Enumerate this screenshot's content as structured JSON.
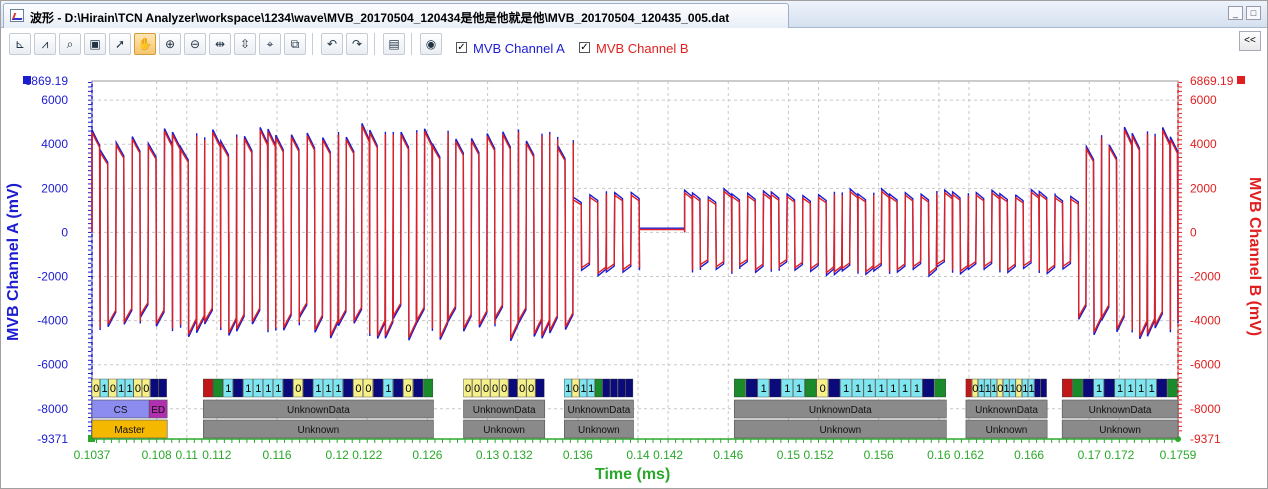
{
  "window": {
    "title": "波形 - D:\\Hirain\\TCN Analyzer\\workspace\\1234\\wave\\MVB_20170504_120434是他是他就是他\\MVB_20170504_120435_005.dat",
    "min_icon": "minimize-icon",
    "max_icon": "maximize-icon",
    "close_icon": "close-icon"
  },
  "toolbar": {
    "tools": [
      "axis-settings-icon",
      "chart-icon",
      "zoom-window-icon",
      "fit-icon",
      "select-pointer-icon",
      "pan-hand-icon",
      "zoom-in-icon",
      "zoom-out-icon",
      "h-expand-icon",
      "v-expand-icon",
      "zoom-region-icon",
      "zoom-box-icon",
      "undo-icon",
      "redo-icon",
      "screenshot-icon",
      "eye-icon"
    ],
    "channel_a_label": "MVB Channel A",
    "channel_b_label": "MVB Channel B",
    "channel_a_checked": true,
    "channel_b_checked": true,
    "collapse_label": "<<"
  },
  "colors": {
    "channel_a": "#1c1cd0",
    "channel_b": "#e02020",
    "x_axis": "#2aa82a",
    "bit_one": "#7fe6f0",
    "bit_zero": "#f5f08a",
    "bit_dark": "#0a0a7a",
    "bit_green": "#1a8a2a",
    "bit_red": "#c01818",
    "cs": "#8b8bf0",
    "ed": "#b030b0",
    "master": "#f5b800",
    "unknown": "#8a8a8a"
  },
  "chart_data": {
    "type": "line",
    "xlabel": "Time (ms)",
    "ylabel_left": "MVB Channel A (mV)",
    "ylabel_right": "MVB Channel B (mV)",
    "xlim": [
      0.1037,
      0.1759
    ],
    "ylim": [
      -9371,
      6869.19
    ],
    "y_max_label": "6869.19",
    "y_min_label": "-9371",
    "y_ticks": [
      6000,
      4000,
      2000,
      0,
      -2000,
      -4000,
      -6000,
      -8000
    ],
    "x_ticks": [
      0.1037,
      0.108,
      0.11,
      0.112,
      0.116,
      0.12,
      0.122,
      0.126,
      0.13,
      0.132,
      0.136,
      0.14,
      0.142,
      0.146,
      0.15,
      0.152,
      0.156,
      0.16,
      0.162,
      0.166,
      0.17,
      0.172,
      0.1759
    ],
    "grid": true,
    "series": [
      {
        "name": "MVB Channel A",
        "color": "#1c1cd0"
      },
      {
        "name": "MVB Channel B",
        "color": "#e02020"
      }
    ],
    "segments": [
      {
        "t0": 0.1037,
        "t1": 0.1128,
        "amp": 4200,
        "cells": 6
      },
      {
        "t0": 0.1128,
        "t1": 0.1357,
        "amp": 4400,
        "cells": 18
      },
      {
        "t0": 0.1357,
        "t1": 0.1401,
        "amp": 1700,
        "cells": 6
      },
      {
        "t0": 0.1401,
        "t1": 0.1431,
        "amp": 130,
        "cells": 0
      },
      {
        "t0": 0.1431,
        "t1": 0.1693,
        "amp": 1700,
        "cells": 24
      },
      {
        "t0": 0.1693,
        "t1": 0.1759,
        "amp": 4300,
        "cells": 7
      }
    ],
    "decode_rows": {
      "bits": [
        {
          "t0": 0.1037,
          "t1": 0.1087,
          "cells": [
            "0",
            "1",
            "0",
            "1",
            "1",
            "0",
            "0",
            "D",
            "D"
          ],
          "kinds": [
            "z",
            "o",
            "z",
            "o",
            "o",
            "z",
            "z",
            "k",
            "k"
          ]
        },
        {
          "t0": 0.1111,
          "t1": 0.1264,
          "cells": [
            "",
            "",
            "1",
            "",
            "1",
            "1",
            "1",
            "1",
            "",
            "0",
            "",
            "1",
            "1",
            "1",
            "",
            "0",
            "0",
            "",
            "1",
            "",
            "0",
            "",
            ""
          ],
          "kinds": [
            "r",
            "g",
            "o",
            "k",
            "o",
            "o",
            "o",
            "o",
            "k",
            "z",
            "k",
            "o",
            "o",
            "o",
            "k",
            "z",
            "z",
            "k",
            "o",
            "k",
            "z",
            "k",
            "g"
          ]
        },
        {
          "t0": 0.1284,
          "t1": 0.1338,
          "cells": [
            "0",
            "0",
            "0",
            "0",
            "0",
            "",
            "0",
            "0",
            ""
          ],
          "kinds": [
            "z",
            "z",
            "z",
            "z",
            "z",
            "k",
            "z",
            "z",
            "k"
          ]
        },
        {
          "t0": 0.1351,
          "t1": 0.1397,
          "cells": [
            "1",
            "0",
            "1",
            "1",
            "",
            "",
            "",
            "",
            ""
          ],
          "kinds": [
            "o",
            "z",
            "o",
            "o",
            "g",
            "k",
            "k",
            "k",
            "k"
          ]
        },
        {
          "t0": 0.1406,
          "t1": 0.1482,
          "cells": [],
          "kinds": []
        },
        {
          "t0": 0.1464,
          "t1": 0.1605,
          "cells": [
            "",
            "",
            "1",
            "",
            "1",
            "1",
            "",
            "0",
            "",
            "1",
            "1",
            "1",
            "1",
            "1",
            "1",
            "1",
            "",
            ""
          ],
          "kinds": [
            "g",
            "k",
            "o",
            "k",
            "o",
            "o",
            "g",
            "z",
            "k",
            "o",
            "o",
            "o",
            "o",
            "o",
            "o",
            "o",
            "k",
            "g"
          ]
        },
        {
          "t0": 0.1618,
          "t1": 0.1672,
          "cells": [
            "",
            "0",
            "1",
            "1",
            "1",
            "0",
            "1",
            "1",
            "0",
            "1",
            "1",
            "",
            ""
          ],
          "kinds": [
            "r",
            "z",
            "o",
            "o",
            "o",
            "z",
            "o",
            "o",
            "z",
            "o",
            "o",
            "k",
            "k"
          ]
        },
        {
          "t0": 0.1682,
          "t1": 0.1759,
          "cells": [
            "",
            "",
            "",
            "1",
            "",
            "1",
            "1",
            "1",
            "1",
            "",
            ""
          ],
          "kinds": [
            "r",
            "g",
            "k",
            "o",
            "k",
            "o",
            "o",
            "o",
            "o",
            "k",
            "g"
          ]
        }
      ],
      "data_labels": [
        {
          "t0": 0.1037,
          "t1": 0.1075,
          "label": "CS",
          "kind": "cs"
        },
        {
          "t0": 0.1075,
          "t1": 0.1087,
          "label": "ED",
          "kind": "ed"
        },
        {
          "t0": 0.1111,
          "t1": 0.1264,
          "label": "UnknownData",
          "kind": "u"
        },
        {
          "t0": 0.1284,
          "t1": 0.1338,
          "label": "UnknownData",
          "kind": "u"
        },
        {
          "t0": 0.1351,
          "t1": 0.1397,
          "label": "UnknownData",
          "kind": "u"
        },
        {
          "t0": 0.1464,
          "t1": 0.1605,
          "label": "UnknownData",
          "kind": "u"
        },
        {
          "t0": 0.1618,
          "t1": 0.1672,
          "label": "UnknownData",
          "kind": "u"
        },
        {
          "t0": 0.1682,
          "t1": 0.1759,
          "label": "UnknownData",
          "kind": "u"
        }
      ],
      "frame_labels": [
        {
          "t0": 0.1037,
          "t1": 0.1087,
          "label": "Master",
          "kind": "m"
        },
        {
          "t0": 0.1111,
          "t1": 0.1264,
          "label": "Unknown",
          "kind": "u"
        },
        {
          "t0": 0.1284,
          "t1": 0.1338,
          "label": "Unknown",
          "kind": "u"
        },
        {
          "t0": 0.1351,
          "t1": 0.1397,
          "label": "Unknown",
          "kind": "u"
        },
        {
          "t0": 0.1464,
          "t1": 0.1605,
          "label": "Unknown",
          "kind": "u"
        },
        {
          "t0": 0.1618,
          "t1": 0.1672,
          "label": "Unknown",
          "kind": "u"
        },
        {
          "t0": 0.1682,
          "t1": 0.1759,
          "label": "Unknown",
          "kind": "u"
        }
      ]
    }
  }
}
